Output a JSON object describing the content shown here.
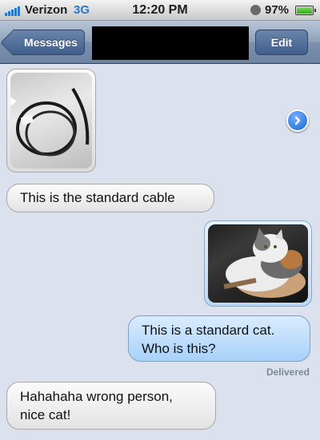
{
  "status_bar": {
    "carrier": "Verizon",
    "network": "3G",
    "time": "12:20 PM",
    "battery": "97%"
  },
  "nav": {
    "back_label": "Messages",
    "edit_label": "Edit"
  },
  "messages": [
    {
      "type": "image",
      "direction": "incoming",
      "subject": "cable"
    },
    {
      "type": "text",
      "direction": "incoming",
      "text": "This is the standard cable"
    },
    {
      "type": "image",
      "direction": "outgoing",
      "subject": "cat"
    },
    {
      "type": "text",
      "direction": "outgoing",
      "lines": [
        "This is a standard cat.",
        "Who is this?"
      ]
    },
    {
      "type": "text",
      "direction": "incoming",
      "lines": [
        "Hahahaha wrong person,",
        "nice cat!"
      ]
    }
  ],
  "delivery_status": "Delivered",
  "colors": {
    "accent": "#2b78c9",
    "background": "#dbe2ed",
    "outgoing_bubble": "#a8d1f8",
    "incoming_bubble": "#e3e3e3"
  },
  "icons": [
    "signal-icon",
    "alarm-icon",
    "battery-icon",
    "disclosure-arrow-icon"
  ]
}
